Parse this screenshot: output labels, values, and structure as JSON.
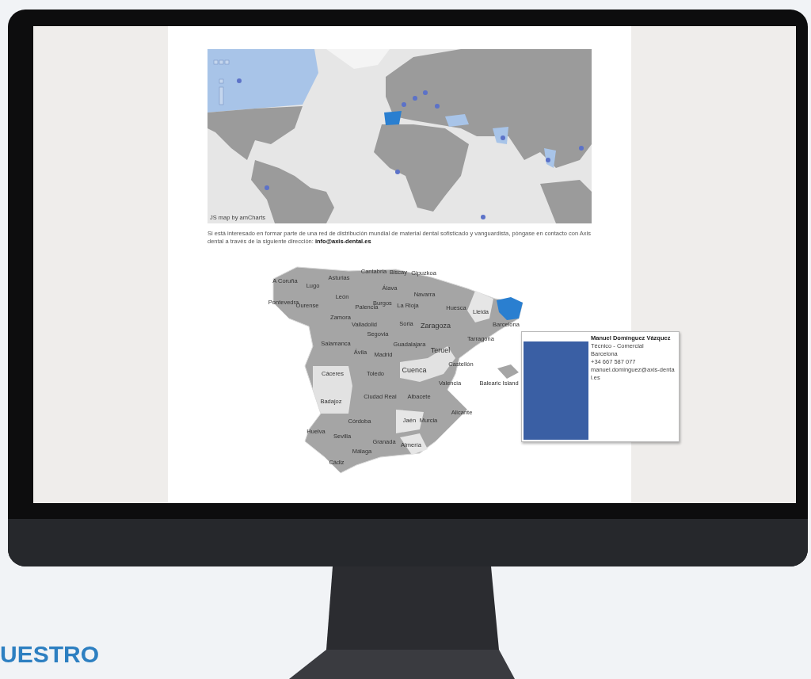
{
  "world_map": {
    "credit": "JS map by amCharts"
  },
  "intro": {
    "text": "Si está interesado en formar parte de una red de distribución mundial de material dental sofisticado y vanguardista, póngase en contacto con Axis dental a través de la siguiente dirección: ",
    "email": "info@axis-dental.es"
  },
  "spain_map": {
    "labels": [
      "A Coruña",
      "Lugo",
      "Asturias",
      "Cantabria",
      "Biscay",
      "Gipuzkoa",
      "Pontevedra",
      "Ourense",
      "León",
      "Álava",
      "Navarra",
      "Palencia",
      "Burgos",
      "La Rioja",
      "Huesca",
      "Lleida",
      "Zamora",
      "Valladolid",
      "Soria",
      "Zaragoza",
      "Barcelona",
      "Segovia",
      "Tarragona",
      "Salamanca",
      "Guadalajara",
      "Ávila",
      "Madrid",
      "Teruel",
      "Castellón",
      "Cuenca",
      "Cáceres",
      "Toledo",
      "Valencia",
      "Balearic Island",
      "Badajoz",
      "Ciudad Real",
      "Albacete",
      "Alicante",
      "Córdoba",
      "Jaén",
      "Murcia",
      "Huelva",
      "Sevilla",
      "Granada",
      "Almería",
      "Málaga",
      "Cádiz"
    ]
  },
  "contact_card": {
    "name": "Manuel Domínguez Vázquez",
    "role": "Técnico - Comercial",
    "city": "Barcelona",
    "phone": "+34 667 587 077",
    "email": "manuel.dominguez@axis-dental.es"
  },
  "heading": "UESTRO"
}
